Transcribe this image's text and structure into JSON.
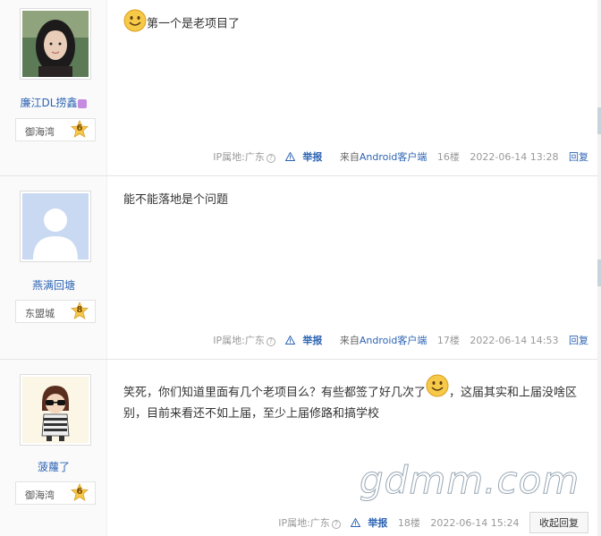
{
  "posts": [
    {
      "username": "廉江DL捞鑫",
      "rank_name": "御海湾",
      "rank_level": "6",
      "content_after_emoji": "第一个是老项目了",
      "ip_label": "IP属地:广东",
      "report": "举报",
      "client_prefix": "来自",
      "client_name": "Android客户端",
      "floor": "16楼",
      "time": "2022-06-14 13:28",
      "reply": "回复"
    },
    {
      "username": "燕满回塘",
      "rank_name": "东盟城",
      "rank_level": "8",
      "content": "能不能落地是个问题",
      "ip_label": "IP属地:广东",
      "report": "举报",
      "client_prefix": "来自",
      "client_name": "Android客户端",
      "floor": "17楼",
      "time": "2022-06-14 14:53",
      "reply": "回复"
    },
    {
      "username": "菠蘿了",
      "rank_name": "御海湾",
      "rank_level": "6",
      "content_line1_a": "笑死，你们知道里面有几个老项目么？有些都签了好几次了",
      "content_line1_b": "，这届其实和上届没啥区",
      "content_line2": "别，目前来看还不如上届，至少上届修路和搞学校",
      "ip_label": "IP属地:广东",
      "report": "举报",
      "floor": "18楼",
      "time": "2022-06-14 15:24",
      "collapse_reply": "收起回复"
    }
  ],
  "watermark": "gdmm.com",
  "colors": {
    "link": "#2d64b3",
    "sidebar_bg": "#fafafa",
    "meta": "#999999"
  },
  "icons": [
    "smile-emoji-icon",
    "question-icon",
    "warning-icon",
    "level-star-icon"
  ]
}
